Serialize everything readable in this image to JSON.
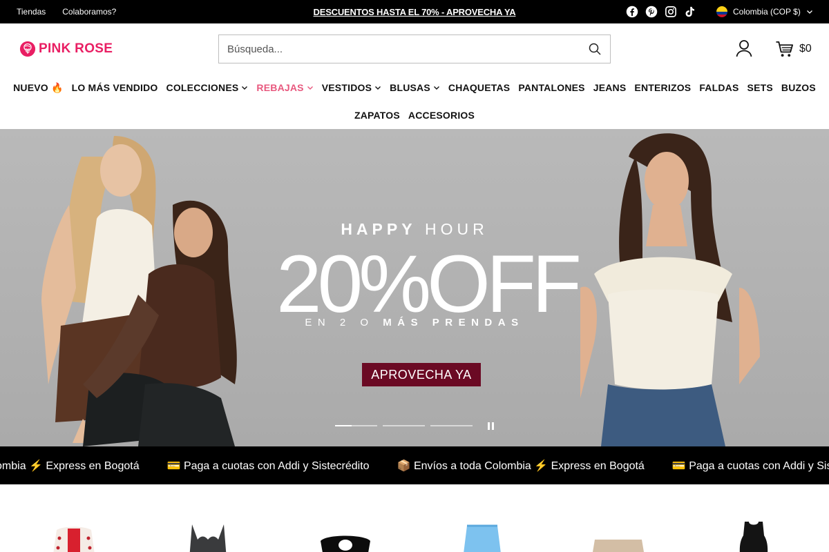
{
  "topbar": {
    "links": [
      "Tiendas",
      "Colaboramos?"
    ],
    "promo": "DESCUENTOS HASTA EL 70% - APROVECHA YA",
    "social_icons": [
      "facebook-icon",
      "pinterest-icon",
      "instagram-icon",
      "tiktok-icon"
    ],
    "locale": "Colombia (COP $)"
  },
  "header": {
    "logo_text": "PINK ROSE",
    "search_placeholder": "Búsqueda...",
    "cart_total": "$0"
  },
  "nav": {
    "row1": [
      {
        "label": "NUEVO 🔥",
        "dropdown": false
      },
      {
        "label": "LO MÁS VENDIDO",
        "dropdown": false
      },
      {
        "label": "COLECCIONES",
        "dropdown": true
      },
      {
        "label": "REBAJAS",
        "dropdown": true,
        "highlight": true
      },
      {
        "label": "VESTIDOS",
        "dropdown": true
      },
      {
        "label": "BLUSAS",
        "dropdown": true
      },
      {
        "label": "CHAQUETAS",
        "dropdown": false
      },
      {
        "label": "PANTALONES",
        "dropdown": false
      },
      {
        "label": "JEANS",
        "dropdown": false
      },
      {
        "label": "ENTERIZOS",
        "dropdown": false
      },
      {
        "label": "FALDAS",
        "dropdown": false
      },
      {
        "label": "SETS",
        "dropdown": false
      },
      {
        "label": "BUZOS",
        "dropdown": false
      }
    ],
    "row2": [
      {
        "label": "ZAPATOS",
        "dropdown": false
      },
      {
        "label": "ACCESORIOS",
        "dropdown": false
      }
    ],
    "highlight_color": "#e8587e"
  },
  "hero": {
    "eyebrow_bold": "HAPPY",
    "eyebrow_light": "HOUR",
    "headline": "20%OFF",
    "sub_light": "EN 2 O",
    "sub_bold": "MÁS PRENDAS",
    "cta": "APROVECHA YA",
    "cta_color": "#6b0a24",
    "slides": 4,
    "active_slide": 1
  },
  "marquee": {
    "messages": [
      "Colombia ⚡ Express en Bogotá",
      "💳 Paga a cuotas con Addi y Sistecrédito",
      "📦 Envíos a toda Colombia ⚡ Express en Bogotá",
      "💳 Paga a cuotas con Addi y Sistecrédito"
    ]
  },
  "categories": {
    "items": [
      "cardigan-thumbnail",
      "bodysuit-thumbnail",
      "black-top-thumbnail",
      "blue-shorts-thumbnail",
      "beige-skirt-thumbnail",
      "black-bodysuit-thumbnail"
    ]
  },
  "brand_color": "#e91e63"
}
